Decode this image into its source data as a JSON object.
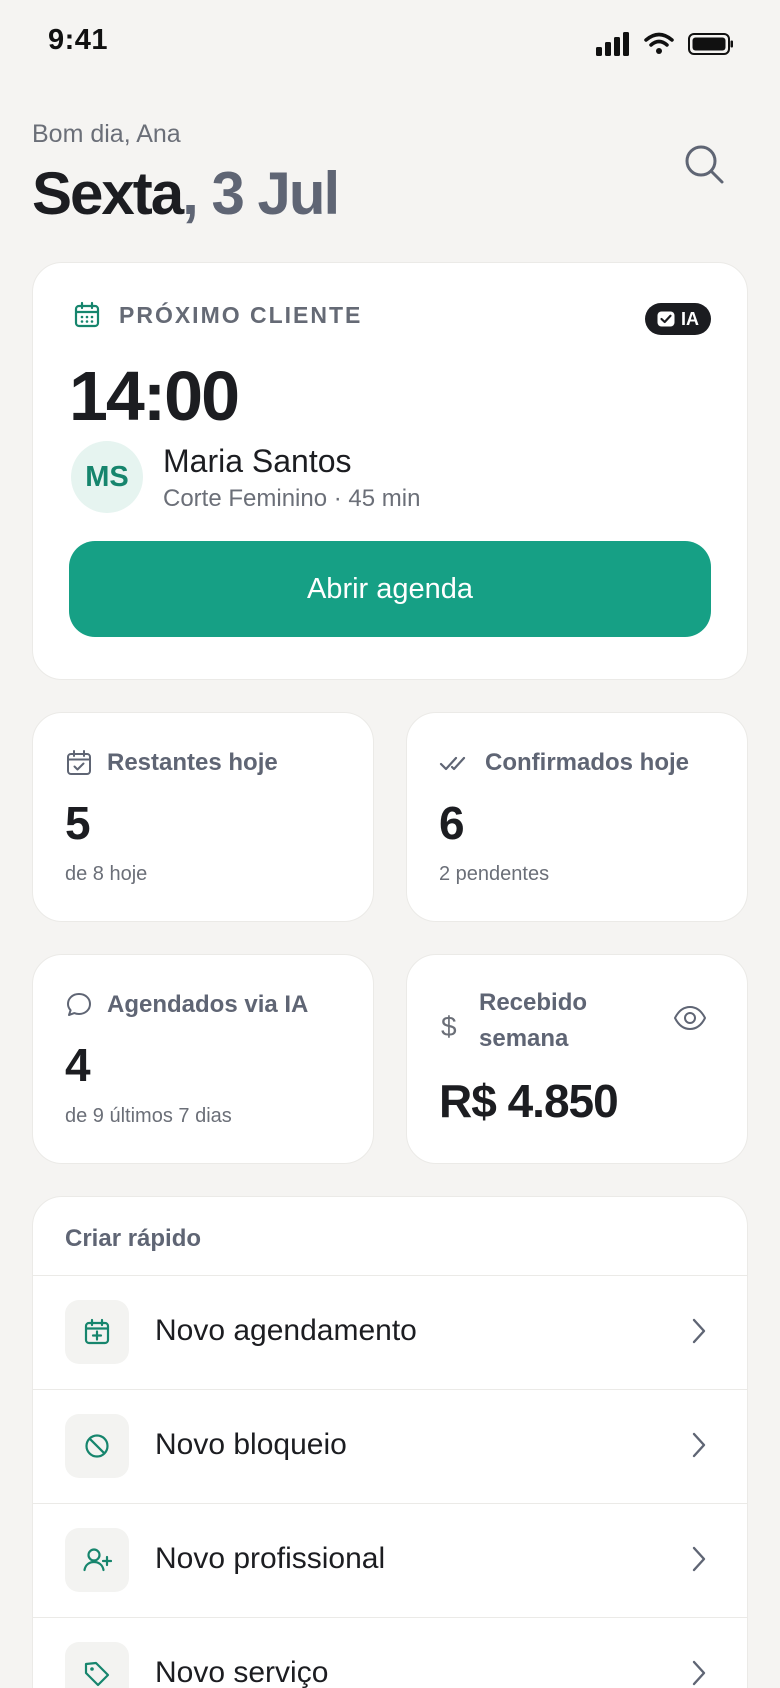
{
  "status": {
    "time": "9:41"
  },
  "header": {
    "greeting": "Bom dia, Ana",
    "title_day": "Sexta",
    "title_date": ", 3 Jul"
  },
  "next_client": {
    "label": "PRÓXIMO CLIENTE",
    "badge": "IA",
    "time": "14:00",
    "avatar_initials": "MS",
    "name": "Maria Santos",
    "meta": "Corte Feminino · 45 min",
    "button": "Abrir agenda"
  },
  "stats": {
    "remaining": {
      "label": "Restantes hoje",
      "value": "5",
      "sub": "de 8 hoje"
    },
    "confirmed": {
      "label": "Confirmados hoje",
      "value": "6",
      "sub": "2 pendentes"
    },
    "ai": {
      "label": "Agendados via IA",
      "value": "4",
      "sub": "de 9 últimos 7 dias"
    },
    "revenue": {
      "label": "Recebido semana",
      "currency_symbol": "$",
      "value": "R$ 4.850"
    }
  },
  "quick": {
    "title": "Criar rápido",
    "items": [
      {
        "label": "Novo agendamento",
        "icon": "calendar-plus-icon"
      },
      {
        "label": "Novo bloqueio",
        "icon": "block-icon"
      },
      {
        "label": "Novo profissional",
        "icon": "user-plus-icon"
      },
      {
        "label": "Novo serviço",
        "icon": "tag-icon"
      }
    ]
  },
  "colors": {
    "accent": "#16a085",
    "accent_dark": "#16856d",
    "background": "#f5f4f2",
    "text": "#1c1d21",
    "muted": "#6b6f78"
  }
}
